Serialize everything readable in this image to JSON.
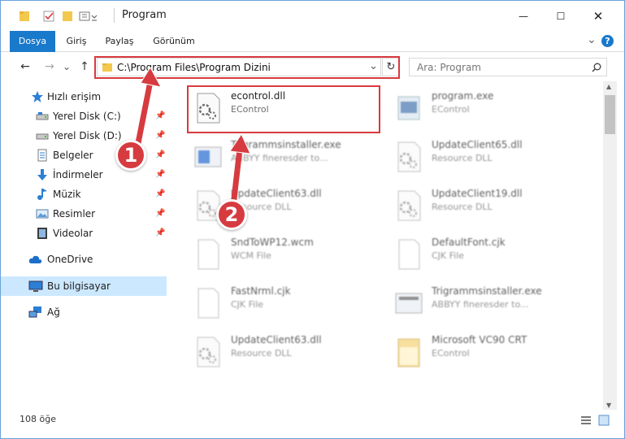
{
  "window": {
    "title": "Program",
    "controls": {
      "minimize": "—",
      "maximize": "☐",
      "close": "✕"
    }
  },
  "ribbon": {
    "tabs": [
      {
        "label": "Dosya",
        "active": true
      },
      {
        "label": "Giriş"
      },
      {
        "label": "Paylaş"
      },
      {
        "label": "Görünüm"
      }
    ],
    "expand_glyph": "⌄",
    "help_glyph": "?"
  },
  "nav": {
    "back": "←",
    "forward": "→",
    "recent": "⌄",
    "up": "↑",
    "address": "C:\\Program Files\\Program Dizini",
    "refresh": "↻",
    "search_placeholder": "Ara: Program"
  },
  "sidebar": {
    "items": [
      {
        "label": "Hızlı erişim",
        "icon": "star-icon"
      },
      {
        "label": "Yerel Disk (C:)",
        "icon": "drive-icon",
        "pinned": true
      },
      {
        "label": "Yerel Disk (D:)",
        "icon": "drive-icon",
        "pinned": true
      },
      {
        "label": "Belgeler",
        "icon": "documents-icon",
        "pinned": true
      },
      {
        "label": "İndirmeler",
        "icon": "downloads-icon",
        "pinned": true
      },
      {
        "label": "Müzik",
        "icon": "music-icon",
        "pinned": true
      },
      {
        "label": "Resimler",
        "icon": "pictures-icon",
        "pinned": true
      },
      {
        "label": "Videolar",
        "icon": "videos-icon",
        "pinned": true
      },
      {
        "label": "OneDrive",
        "icon": "cloud-icon"
      },
      {
        "label": "Bu bilgisayar",
        "icon": "computer-icon",
        "selected": true
      },
      {
        "label": "Ağ",
        "icon": "network-icon"
      }
    ]
  },
  "files": [
    {
      "name": "econtrol.dll",
      "desc": "EControl",
      "icon": "dll-icon",
      "highlighted": true
    },
    {
      "name": "program.exe",
      "desc": "EControl",
      "icon": "exe-icon"
    },
    {
      "name": "Trigrammsinstaller.exe",
      "desc": "ABBYY fineresder to...",
      "icon": "installer-icon"
    },
    {
      "name": "UpdateClient65.dll",
      "desc": "Resource DLL",
      "icon": "dll-icon"
    },
    {
      "name": "UpdateClient63.dll",
      "desc": "Resource DLL",
      "icon": "dll-icon"
    },
    {
      "name": "UpdateClient19.dll",
      "desc": "Resource DLL",
      "icon": "dll-icon"
    },
    {
      "name": "SndToWP12.wcm",
      "desc": "WCM File",
      "icon": "file-icon"
    },
    {
      "name": "DefaultFont.cjk",
      "desc": "CJK File",
      "icon": "file-icon"
    },
    {
      "name": "FastNrml.cjk",
      "desc": "CJK File",
      "icon": "file-icon"
    },
    {
      "name": "Trigrammsinstaller.exe",
      "desc": "ABBYY fineresder to...",
      "icon": "installer-icon"
    },
    {
      "name": "UpdateClient63.dll",
      "desc": "Resource DLL",
      "icon": "dll-icon"
    },
    {
      "name": "Microsoft VC90 CRT",
      "desc": "EControl",
      "icon": "folder-icon"
    }
  ],
  "status": {
    "count": "108 öğe"
  },
  "callouts": [
    "1",
    "2"
  ],
  "colors": {
    "accent": "#1979ca",
    "highlight": "#d93a3f",
    "selection": "#cce8ff"
  }
}
